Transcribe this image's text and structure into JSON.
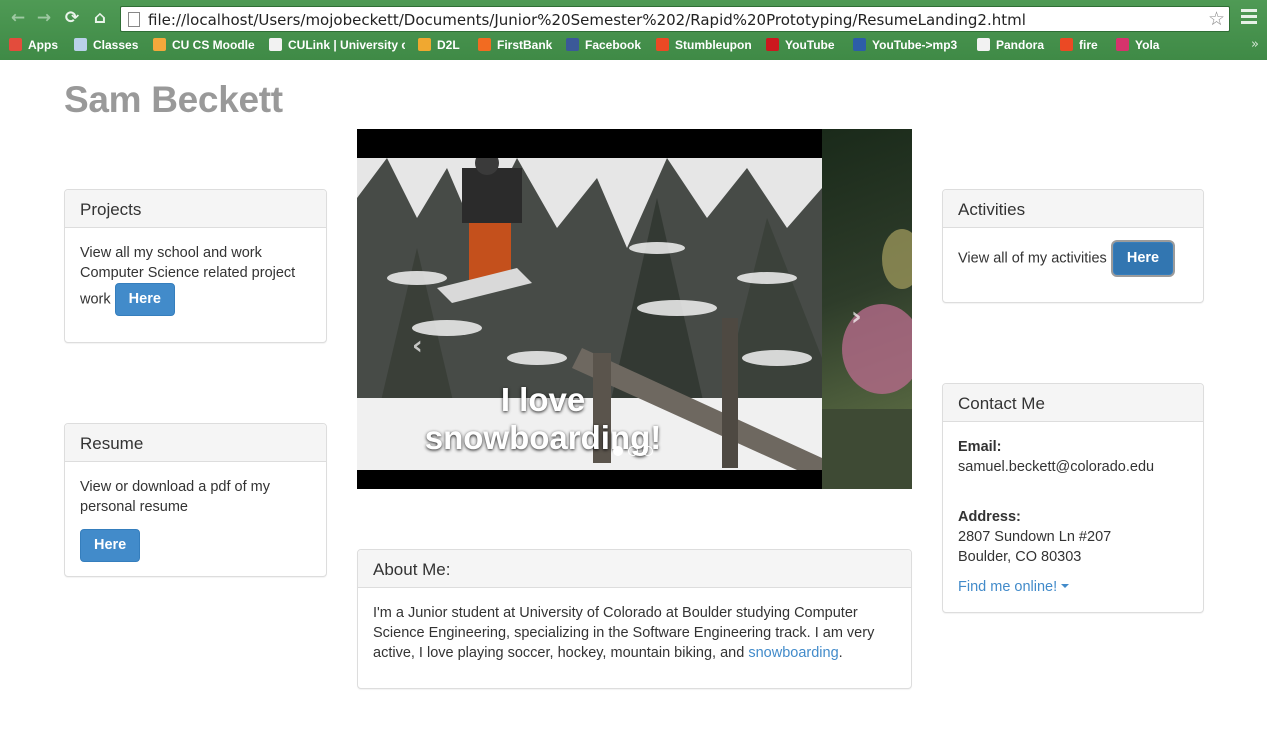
{
  "browser": {
    "nav": {
      "back": "←",
      "forward": "→",
      "reload": "⟳",
      "home": "⌂"
    },
    "url": "file://localhost/Users/mojobeckett/Documents/Junior%20Semester%202/Rapid%20Prototyping/ResumeLanding2.html",
    "star": "☆",
    "bookmarks": [
      {
        "label": "Apps",
        "icon": "apps-grid-icon",
        "color": "#e34c3c"
      },
      {
        "label": "Classes",
        "icon": "folder-icon",
        "color": "#b9d1ea"
      },
      {
        "label": "CU CS Moodle",
        "icon": "moodle-icon",
        "color": "#f4a83b"
      },
      {
        "label": "CULink | University o",
        "icon": "page-icon",
        "color": "#f2f2f2"
      },
      {
        "label": "D2L",
        "icon": "d2l-icon",
        "color": "#f0a830"
      },
      {
        "label": "FirstBank",
        "icon": "firstbank-icon",
        "color": "#f26b21"
      },
      {
        "label": "Facebook",
        "icon": "facebook-icon",
        "color": "#3b5998"
      },
      {
        "label": "Stumbleupon",
        "icon": "stumbleupon-icon",
        "color": "#eb4924"
      },
      {
        "label": "YouTube",
        "icon": "youtube-icon",
        "color": "#cc181e"
      },
      {
        "label": "YouTube->mp3",
        "icon": "yt-mp3-icon",
        "color": "#2d5da8"
      },
      {
        "label": "Pandora",
        "icon": "pandora-icon",
        "color": "#f2f2f2"
      },
      {
        "label": "fire",
        "icon": "stumbleupon-icon",
        "color": "#eb4924"
      },
      {
        "label": "Yola",
        "icon": "yola-icon",
        "color": "#d6336c"
      }
    ],
    "more": "»"
  },
  "page": {
    "name": "Sam Beckett",
    "projects": {
      "title": "Projects",
      "text": "View all my school and work Computer Science related project work",
      "button": "Here"
    },
    "resume": {
      "title": "Resume",
      "text": "View or download a pdf of my personal resume",
      "button": "Here"
    },
    "carousel": {
      "caption_line1": "I love",
      "caption_line2": "snowboarding!",
      "prev": "‹",
      "next": "›",
      "slides": 3,
      "active": 0
    },
    "about": {
      "title": "About Me:",
      "text": "I'm a Junior student at University of Colorado at Boulder studying Computer Science Engineering, specializing in the Software Engineering track. I am very active, I love playing soccer, hockey, mountain biking, and ",
      "link": "snowboarding",
      "tail": "."
    },
    "activities": {
      "title": "Activities",
      "text": "View all of my activities",
      "button": "Here"
    },
    "contact": {
      "title": "Contact Me",
      "email_label": "Email:",
      "email": "samuel.beckett@colorado.edu",
      "address_label": "Address:",
      "address_line1": "2807 Sundown Ln #207",
      "address_line2": "Boulder, CO 80303",
      "find_online": "Find me online!"
    }
  }
}
